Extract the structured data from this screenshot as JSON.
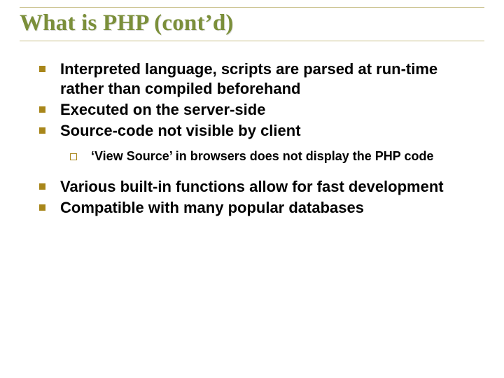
{
  "title": "What is PHP (cont’d)",
  "bullets": {
    "b1": "Interpreted language, scripts are parsed at run-time rather than compiled beforehand",
    "b2": "Executed on the server-side",
    "b3": "Source-code not visible by client",
    "sub1": "‘View Source’ in browsers does not display the PHP code",
    "b4": "Various built-in functions allow for fast development",
    "b5": "Compatible with many popular databases"
  }
}
